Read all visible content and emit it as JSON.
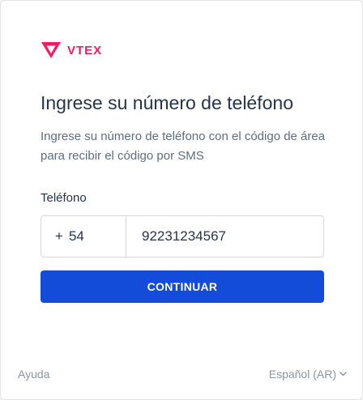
{
  "brand": {
    "name": "VTEX",
    "color": "#f71963"
  },
  "header": {
    "title": "Ingrese su número de teléfono"
  },
  "description": "Ingrese su número de teléfono con el código de área para recibir el código por SMS",
  "phone": {
    "label": "Teléfono",
    "country_prefix_symbol": "+",
    "country_code": "54",
    "value": "92231234567"
  },
  "actions": {
    "continue_label": "CONTINUAR",
    "primary_color": "#134cd8"
  },
  "footer": {
    "help_label": "Ayuda",
    "language_label": "Español (AR)",
    "language_icon": "chevron-down-icon"
  }
}
